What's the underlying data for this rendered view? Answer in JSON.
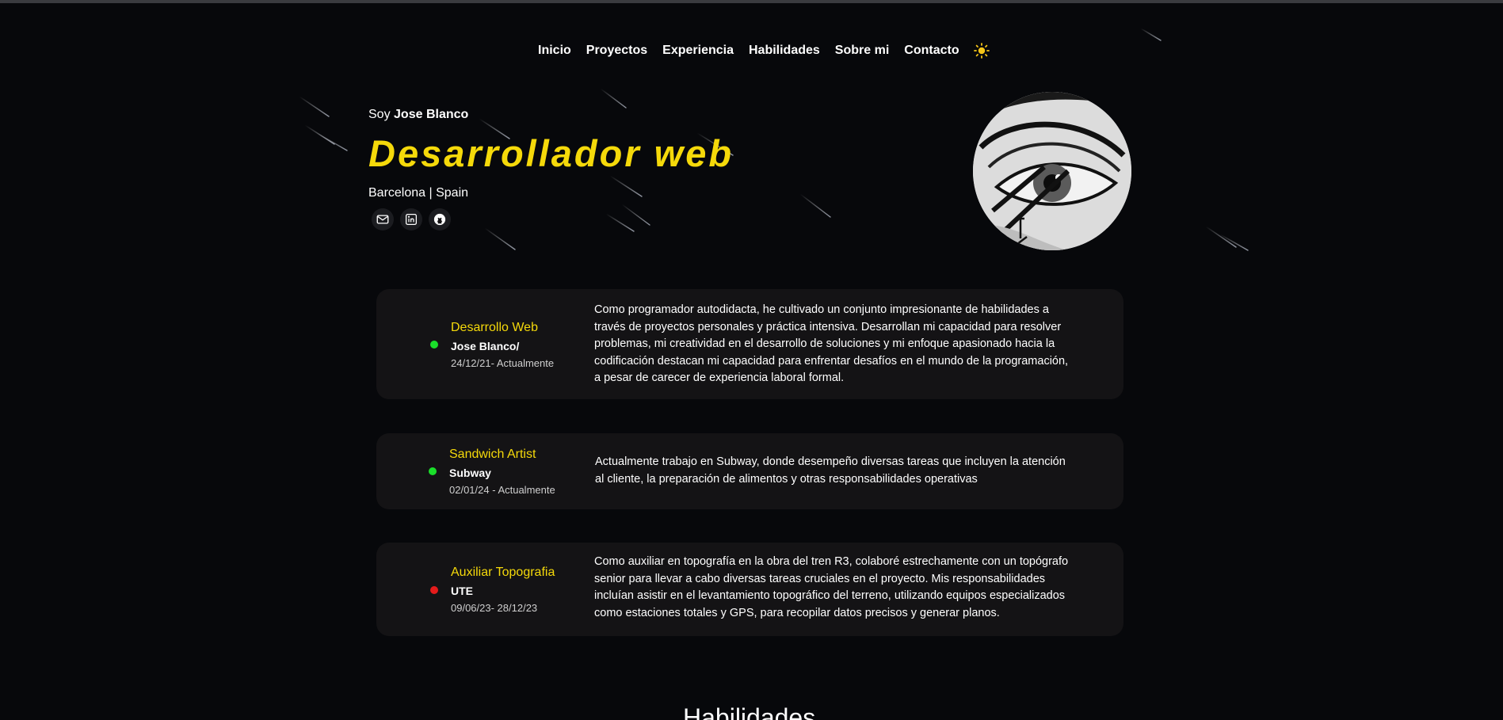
{
  "nav": {
    "items": [
      "Inicio",
      "Proyectos",
      "Experiencia",
      "Habilidades",
      "Sobre mi",
      "Contacto"
    ],
    "theme_icon": "sun-icon"
  },
  "hero": {
    "greeting": "Soy",
    "name": "Jose Blanco",
    "role": "Desarrollador web",
    "location": "Barcelona | Spain",
    "socials": [
      "mail-icon",
      "linkedin-icon",
      "github-icon"
    ]
  },
  "experience": [
    {
      "title": "Desarrollo Web",
      "company": "Jose Blanco/",
      "dates": "24/12/21- Actualmente",
      "status_color": "#1adf2a",
      "description": "Como programador autodidacta, he cultivado un conjunto impresionante de habilidades a través de proyectos personales y práctica intensiva. Desarrollan mi capacidad para resolver problemas, mi creatividad en el desarrollo de soluciones y mi enfoque apasionado hacia la codificación destacan mi capacidad para enfrentar desafíos en el mundo de la programación, a pesar de carecer de experiencia laboral formal."
    },
    {
      "title": "Sandwich Artist",
      "company": "Subway",
      "dates": "02/01/24 - Actualmente",
      "status_color": "#1adf2a",
      "description": "Actualmente trabajo en Subway, donde desempeño diversas tareas que incluyen la atención al cliente, la preparación de alimentos y otras responsabilidades operativas"
    },
    {
      "title": "Auxiliar Topografia",
      "company": "UTE",
      "dates": "09/06/23- 28/12/23",
      "status_color": "#e51b1b",
      "description": "Como auxiliar en topografía en la obra del tren R3, colaboré estrechamente con un topógrafo senior para llevar a cabo diversas tareas cruciales en el proyecto. Mis responsabilidades incluían asistir en el levantamiento topográfico del terreno, utilizando equipos especializados como estaciones totales y GPS, para recopilar datos precisos y generar planos."
    }
  ],
  "skills": {
    "title": "Habilidades"
  },
  "colors": {
    "accent": "#f5d90a",
    "background": "#07080b",
    "card": "#141315"
  }
}
